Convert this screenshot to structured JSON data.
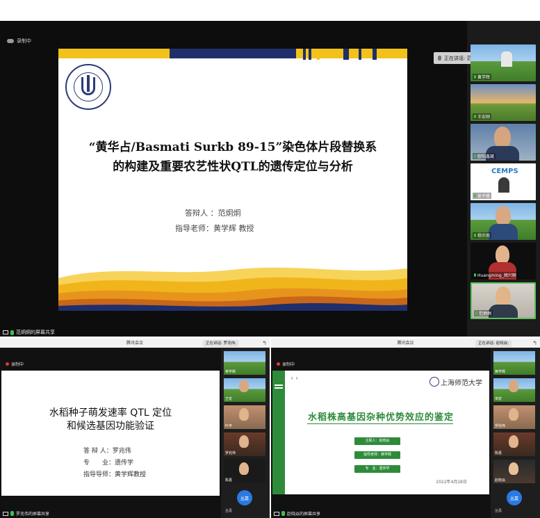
{
  "top": {
    "recording_label": "录制中",
    "speaking_label": "正在讲话: 范炯炯;",
    "sharer_label": "范炯炯的屏幕共享",
    "slide": {
      "title_line1": "“黄华占/Basmati Surkb 89-15”染色体片段替换系",
      "title_line2": "的构建及重要农艺性状QTL的遗传定位与分析",
      "defender": "答辩人 ：范炯炯",
      "advisor": "指导老师：黄学辉 教授"
    },
    "participants": [
      {
        "name": "黄学辉"
      },
      {
        "name": "王宏刚"
      },
      {
        "name": "欧阳鑫斌"
      },
      {
        "name": "吴子睿"
      },
      {
        "name": "杨宗南"
      },
      {
        "name": "Huangming_胡兴刚"
      },
      {
        "name": "范炯炯"
      }
    ],
    "cemps_text": "CEMPS"
  },
  "bottom_left": {
    "window_title": "腾讯会议",
    "speaking_label": "正在讲话: 罗兆伟;",
    "recording_label": "录制中",
    "sharer_label": "罗兆伟的屏幕共享",
    "fab_label": "丛嘉",
    "slide": {
      "title_line1": "水稻种子萌发速率 QTL 定位",
      "title_line2": "和候选基因功能验证",
      "info": [
        {
          "k": "答 辩 人：",
          "v": "罗兆伟"
        },
        {
          "k": "专　　业：",
          "v": "遗传学"
        },
        {
          "k": "指导导师：",
          "v": "黄学辉教授"
        }
      ]
    },
    "participants": [
      {
        "name": "黄学辉"
      },
      {
        "name": "王宏"
      },
      {
        "name": "叶宇"
      },
      {
        "name": "罗兆伟"
      },
      {
        "name": "陈嘉"
      }
    ],
    "bottom_name": "丛嘉"
  },
  "bottom_right": {
    "window_title": "腾讯会议",
    "speaking_label": "正在讲话: 赵晓焱;",
    "recording_label": "录制中",
    "sharer_label": "赵晓焱的屏幕共享",
    "fab_label": "丛嘉",
    "slide": {
      "school": "上海师范大学",
      "title": "水稻株高基因杂种优势效应的鉴定",
      "pills": [
        "主报人：赵晓焱",
        "指导老师：黄学辉",
        "专　业：遗传学"
      ],
      "date": "2022年4月28日"
    },
    "participants": [
      {
        "name": "黄学辉"
      },
      {
        "name": "宋宏"
      },
      {
        "name": "罗兆伟"
      },
      {
        "name": "陈嘉"
      },
      {
        "name": "赵晓焱"
      }
    ],
    "bottom_name": "丛嘉"
  },
  "colors": {
    "accent_green": "#2e8b3a",
    "slide_yellow": "#f3c21a",
    "slide_navy": "#1f2f6b",
    "active_border": "#5ac05a"
  }
}
